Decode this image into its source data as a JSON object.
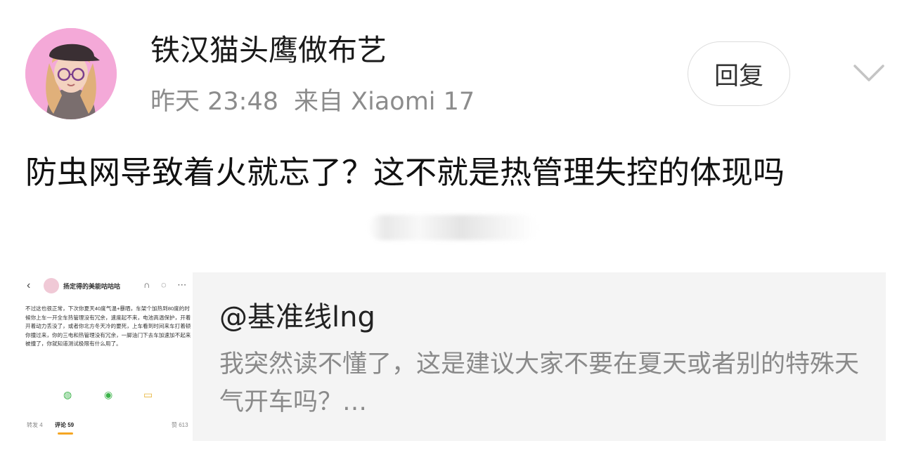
{
  "post": {
    "username": "铁汉猫头鹰做布艺",
    "time": "昨天 23:48",
    "source": "来自 Xiaomi 17",
    "reply_label": "回复",
    "text": "防虫网导致着火就忘了？这不就是热管理失控的体现吗"
  },
  "quote": {
    "author": "@基准线lng",
    "text": "我突然读不懂了，这是建议大家不要在夏天或者别的特殊天气开车吗？…",
    "thumbnail": {
      "back_icon": "‹",
      "name": "扬定得的美能咕咕咕",
      "header_icons": "∩ ◌ ⋯",
      "body": "不过这也很正常，下次你夏天40度气温+暴晒，车架个加热到80度的时候你上车一开全车热管理没有冗余，速度起不来，电池高温保护，开着开着动力丢没了，或者你北方冬天冷的要死，上车看到时间来车打着顿你撞过来，你的三电和热管理没有冗余，一脚油门下去车加速加不起来被撞了，你就知道测试极限有什么用了。",
      "footer_repost": "转发 4",
      "footer_comment": "评论 59",
      "footer_like": "赞 613"
    }
  }
}
